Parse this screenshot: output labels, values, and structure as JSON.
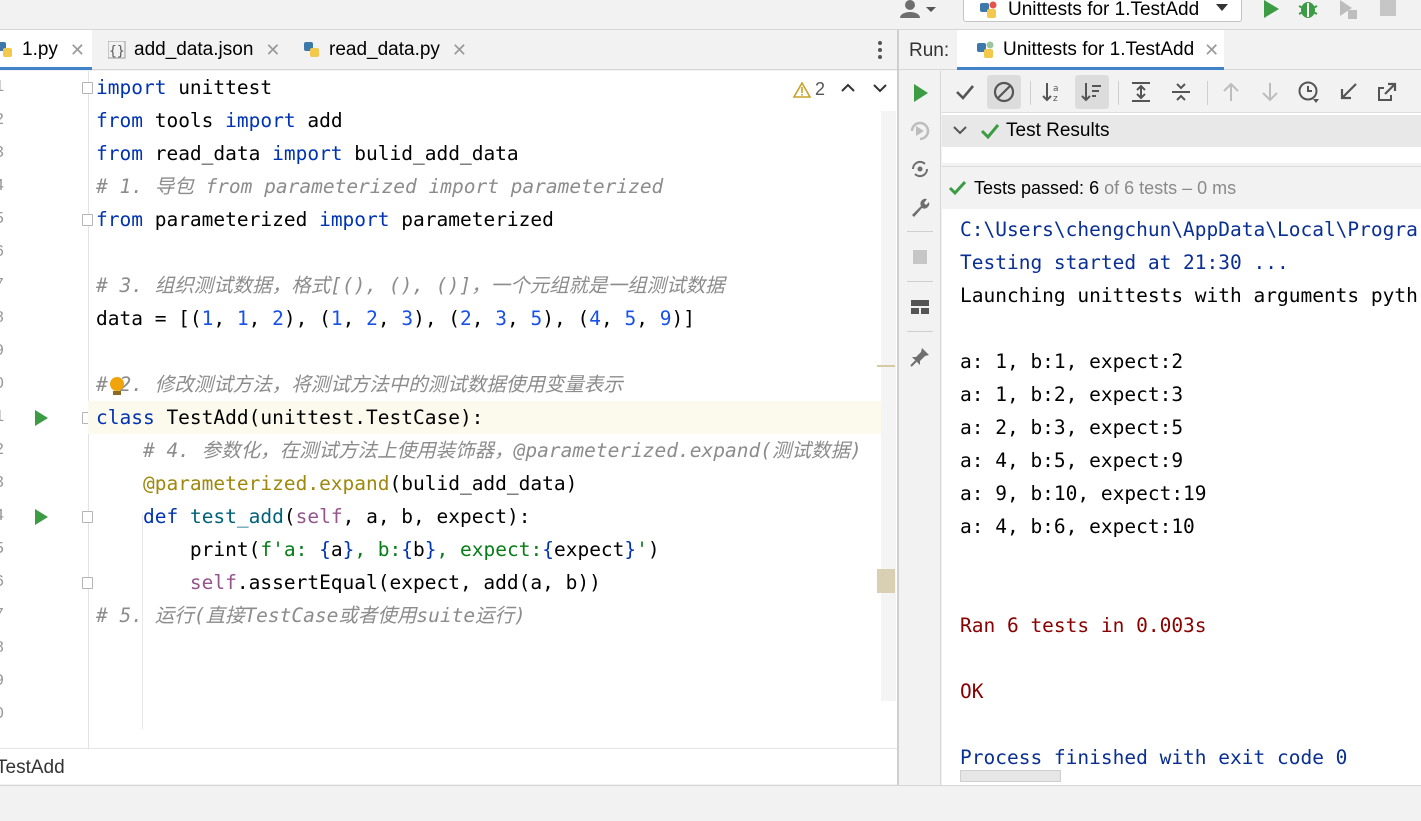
{
  "toolbar": {
    "run_config_label": "Unittests for 1.TestAdd"
  },
  "editor": {
    "tabs": [
      {
        "label": "1.py",
        "active": true
      },
      {
        "label": "add_data.json",
        "active": false
      },
      {
        "label": "read_data.py",
        "active": false
      }
    ],
    "warning_count": "2",
    "line_numbers": [
      "1",
      "2",
      "3",
      "4",
      "5",
      "6",
      "7",
      "8",
      "9",
      "0",
      "1",
      "2",
      "3",
      "4",
      "5",
      "6",
      "7",
      "8",
      "9",
      "0"
    ],
    "breadcrumb": "TestAdd"
  },
  "run_panel": {
    "label": "Run:",
    "tab_label": "Unittests for 1.TestAdd",
    "tree_root": "Test Results",
    "status": {
      "prefix": "Tests passed: ",
      "passed": "6",
      "suffix": " of 6 tests – 0 ms"
    },
    "console": [
      {
        "text": "C:\\Users\\chengchun\\AppData\\Local\\Progra",
        "style": "blue"
      },
      {
        "text": "Testing started at 21:30 ...",
        "style": "blue"
      },
      {
        "text": "Launching unittests with arguments pyth",
        "style": "plain"
      },
      {
        "text": "",
        "style": "plain"
      },
      {
        "text": "a: 1, b:1, expect:2",
        "style": "plain"
      },
      {
        "text": "a: 1, b:2, expect:3",
        "style": "plain"
      },
      {
        "text": "a: 2, b:3, expect:5",
        "style": "plain"
      },
      {
        "text": "a: 4, b:5, expect:9",
        "style": "plain"
      },
      {
        "text": "a: 9, b:10, expect:19",
        "style": "plain"
      },
      {
        "text": "a: 4, b:6, expect:10",
        "style": "plain"
      },
      {
        "text": "",
        "style": "plain"
      },
      {
        "text": "",
        "style": "plain"
      },
      {
        "text": "Ran 6 tests in 0.003s",
        "style": "red"
      },
      {
        "text": "",
        "style": "plain"
      },
      {
        "text": "OK",
        "style": "red"
      },
      {
        "text": "",
        "style": "plain"
      },
      {
        "text": "Process finished with exit code 0",
        "style": "blue"
      }
    ]
  },
  "code": [
    [
      [
        "import",
        "kw"
      ],
      [
        " unittest",
        ""
      ]
    ],
    [
      [
        "from",
        "kw"
      ],
      [
        " tools ",
        ""
      ],
      [
        "import",
        "kw"
      ],
      [
        " add",
        ""
      ]
    ],
    [
      [
        "from",
        "kw"
      ],
      [
        " read_data ",
        ""
      ],
      [
        "import",
        "kw"
      ],
      [
        " bulid_add_data",
        ""
      ]
    ],
    [
      [
        "# 1. 导包 from parameterized import parameterized",
        "cm"
      ]
    ],
    [
      [
        "from",
        "kw"
      ],
      [
        " parameterized ",
        ""
      ],
      [
        "import",
        "kw"
      ],
      [
        " parameterized",
        ""
      ]
    ],
    [],
    [
      [
        "# 3. 组织测试数据，格式[(), (), ()]，一个元组就是一组测试数据",
        "cm"
      ]
    ],
    [
      [
        "data = [(",
        ""
      ],
      [
        "1",
        "num"
      ],
      [
        ", ",
        ""
      ],
      [
        "1",
        "num"
      ],
      [
        ", ",
        ""
      ],
      [
        "2",
        "num"
      ],
      [
        "), (",
        ""
      ],
      [
        "1",
        "num"
      ],
      [
        ", ",
        ""
      ],
      [
        "2",
        "num"
      ],
      [
        ", ",
        ""
      ],
      [
        "3",
        "num"
      ],
      [
        "), (",
        ""
      ],
      [
        "2",
        "num"
      ],
      [
        ", ",
        ""
      ],
      [
        "3",
        "num"
      ],
      [
        ", ",
        ""
      ],
      [
        "5",
        "num"
      ],
      [
        "), (",
        ""
      ],
      [
        "4",
        "num"
      ],
      [
        ", ",
        ""
      ],
      [
        "5",
        "num"
      ],
      [
        ", ",
        ""
      ],
      [
        "9",
        "num"
      ],
      [
        ")]",
        ""
      ]
    ],
    [],
    [
      [
        "# 2. 修改测试方法，将测试方法中的测试数据使用变量表示",
        "cm"
      ]
    ],
    [
      [
        "class",
        "kw"
      ],
      [
        " TestAdd(unittest.TestCase):",
        ""
      ]
    ],
    [
      [
        "    # 4. 参数化，在测试方法上使用装饰器，@parameterized.expand(测试数据)",
        "cm"
      ]
    ],
    [
      [
        "    ",
        ""
      ],
      [
        "@parameterized.expand",
        "dec"
      ],
      [
        "(bulid_add_data)",
        ""
      ]
    ],
    [
      [
        "    ",
        ""
      ],
      [
        "def",
        "kw"
      ],
      [
        " ",
        ""
      ],
      [
        "test_add",
        "fn"
      ],
      [
        "(",
        ""
      ],
      [
        "self",
        "slf"
      ],
      [
        ", a, b, expect):",
        ""
      ]
    ],
    [
      [
        "        print(",
        ""
      ],
      [
        "f'a: ",
        "str"
      ],
      [
        "{",
        "kw"
      ],
      [
        "a",
        ""
      ],
      [
        "}",
        "kw"
      ],
      [
        ", b:",
        "str"
      ],
      [
        "{",
        "kw"
      ],
      [
        "b",
        ""
      ],
      [
        "}",
        "kw"
      ],
      [
        ", expect:",
        "str"
      ],
      [
        "{",
        "kw"
      ],
      [
        "expect",
        ""
      ],
      [
        "}",
        "kw"
      ],
      [
        "'",
        "str"
      ],
      [
        ")",
        ""
      ]
    ],
    [
      [
        "        ",
        ""
      ],
      [
        "self",
        "slf"
      ],
      [
        ".assertEqual(expect, add(a, b))",
        ""
      ]
    ],
    [
      [
        "# 5. 运行(直接TestCase或者使用suite运行)",
        "cm"
      ]
    ]
  ],
  "colors": {
    "accent": "#4083c9",
    "run_green": "#3b9c44",
    "keyword": "#0033b3",
    "number": "#1750eb",
    "comment": "#8c8c8c"
  }
}
